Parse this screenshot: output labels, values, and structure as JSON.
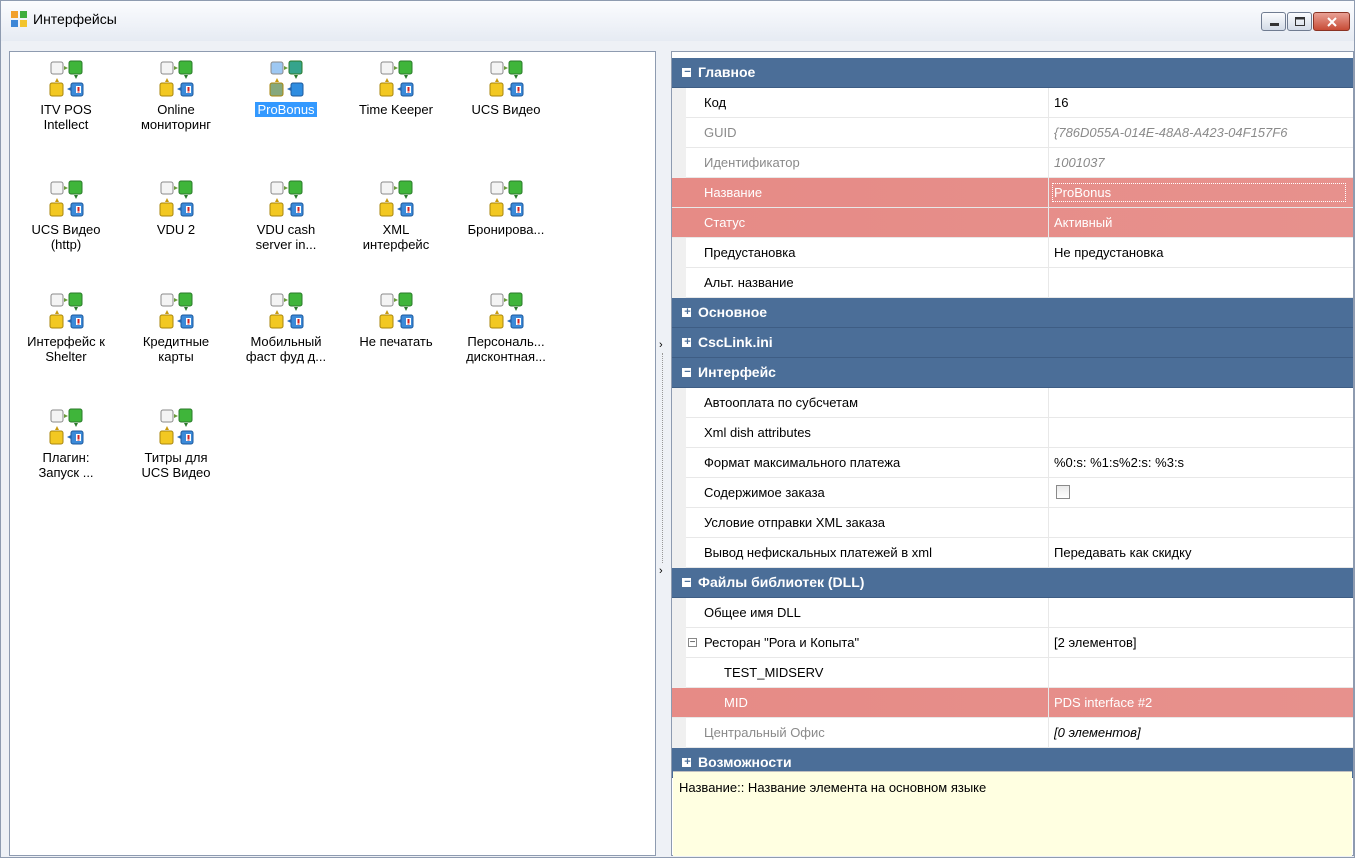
{
  "window": {
    "title": "Интерфейсы",
    "controls": {
      "minimize": "—",
      "maximize": "□",
      "close": "✕"
    }
  },
  "icons": [
    {
      "label": "ITV POS Intellect",
      "lines": [
        "ITV POS",
        "Intellect"
      ],
      "selected": false
    },
    {
      "label": "Online мониторинг",
      "lines": [
        "Online",
        "мониторинг"
      ],
      "selected": false
    },
    {
      "label": "ProBonus",
      "lines": [
        "ProBonus"
      ],
      "selected": true
    },
    {
      "label": "Time Keeper",
      "lines": [
        "Time Keeper"
      ],
      "selected": false
    },
    {
      "label": "UCS Видео",
      "lines": [
        "UCS Видео"
      ],
      "selected": false
    },
    {
      "label": "UCS Видео (http)",
      "lines": [
        "UCS Видео",
        "(http)"
      ],
      "selected": false
    },
    {
      "label": "VDU 2",
      "lines": [
        "VDU 2"
      ],
      "selected": false
    },
    {
      "label": "VDU cash server in...",
      "lines": [
        "VDU cash",
        "server in..."
      ],
      "selected": false
    },
    {
      "label": "XML интерфейс",
      "lines": [
        "XML",
        "интерфейс"
      ],
      "selected": false
    },
    {
      "label": "Бронирова...",
      "lines": [
        "Бронирова..."
      ],
      "selected": false
    },
    {
      "label": "Интерфейс к Shelter",
      "lines": [
        "Интерфейс к",
        "Shelter"
      ],
      "selected": false
    },
    {
      "label": "Кредитные карты",
      "lines": [
        "Кредитные",
        "карты"
      ],
      "selected": false
    },
    {
      "label": "Мобильный фаст фуд д...",
      "lines": [
        "Мобильный",
        "фаст фуд д..."
      ],
      "selected": false
    },
    {
      "label": "Не печатать",
      "lines": [
        "Не печатать"
      ],
      "selected": false
    },
    {
      "label": "Персональ... дисконтная...",
      "lines": [
        "Персональ...",
        "дисконтная..."
      ],
      "selected": false
    },
    {
      "label": "Плагин: Запуск ...",
      "lines": [
        "Плагин:",
        "Запуск ..."
      ],
      "selected": false
    },
    {
      "label": "Титры для UCS Видео",
      "lines": [
        "Титры для",
        "UCS Видео"
      ],
      "selected": false
    }
  ],
  "properties": {
    "cat_main": {
      "title": "Главное",
      "toggle": "−"
    },
    "kod": {
      "name": "Код",
      "value": "16"
    },
    "guid": {
      "name": "GUID",
      "value": "{786D055A-014E-48A8-A423-04F157F6"
    },
    "ident": {
      "name": "Идентификатор",
      "value": "1001037"
    },
    "nazv": {
      "name": "Название",
      "value": "ProBonus"
    },
    "status": {
      "name": "Статус",
      "value": "Активный"
    },
    "preset": {
      "name": "Предустановка",
      "value": "Не предустановка"
    },
    "altname": {
      "name": "Альт. название",
      "value": ""
    },
    "cat_basic": {
      "title": "Основное",
      "toggle": "+"
    },
    "cat_csclink": {
      "title": "CscLink.ini",
      "toggle": "+"
    },
    "cat_interface": {
      "title": "Интерфейс",
      "toggle": "−"
    },
    "autopay": {
      "name": "Автооплата по субсчетам",
      "value": ""
    },
    "xmldish": {
      "name": "Xml dish attributes",
      "value": ""
    },
    "maxpay": {
      "name": "Формат максимального платежа",
      "value": "%0:s: %1:s%2:s: %3:s"
    },
    "order_content": {
      "name": "Содержимое заказа",
      "value": ""
    },
    "xml_cond": {
      "name": "Условие отправки XML заказа",
      "value": ""
    },
    "nonfiscal": {
      "name": "Вывод нефискальных платежей в xml",
      "value": "Передавать как скидку"
    },
    "cat_dll": {
      "title": "Файлы библиотек (DLL)",
      "toggle": "−"
    },
    "dllname": {
      "name": "Общее имя DLL",
      "value": ""
    },
    "restaurant": {
      "name": "Ресторан \"Рога и Копыта\"",
      "value": "[2 элементов]",
      "toggle": "−"
    },
    "test_midserv": {
      "name": "TEST_MIDSERV",
      "value": ""
    },
    "mid": {
      "name": "MID",
      "value": "PDS interface #2"
    },
    "central": {
      "name": "Центральный Офис",
      "value": "[0 элементов]"
    },
    "cat_features": {
      "title": "Возможности",
      "toggle": "+"
    }
  },
  "description": {
    "text": "Название:: Название элемента на основном языке"
  },
  "colors": {
    "category_bg": "#4b6e98",
    "highlight": "#e37e79",
    "selection": "#3399ff",
    "description_bg": "#ffffe1"
  }
}
